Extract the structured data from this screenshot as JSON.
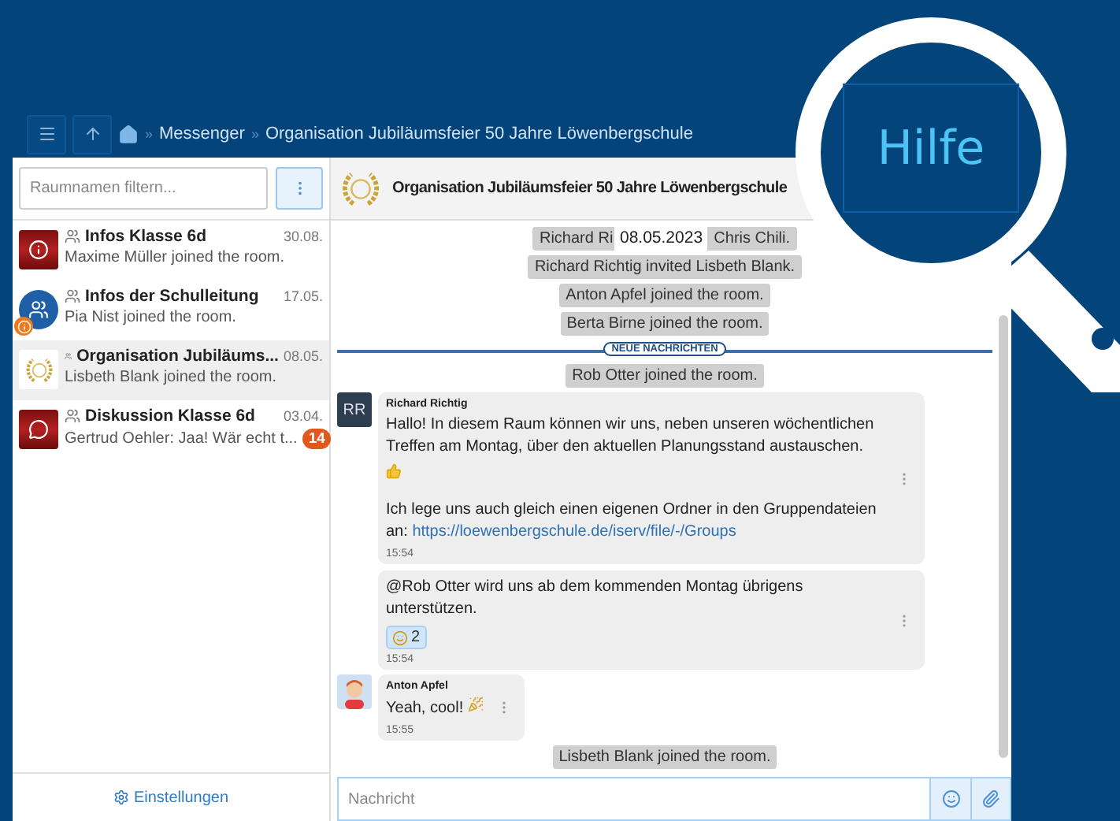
{
  "topbar": {
    "separator": "»",
    "breadcrumb": [
      "Messenger",
      "Organisation Jubiläumsfeier 50 Jahre Löwenbergschule"
    ]
  },
  "sidebar": {
    "filter": {
      "placeholder": "Raumnamen filtern..."
    },
    "rooms": [
      {
        "name": "Infos Klasse 6d",
        "date": "30.08.",
        "preview": "Maxime Müller joined the room.",
        "kind": "class-info",
        "selected": false
      },
      {
        "name": "Infos der Schulleitung",
        "date": "17.05.",
        "preview": "Pia Nist joined the room.",
        "kind": "school",
        "selected": false
      },
      {
        "name": "Organisation Jubiläums...",
        "date": "08.05.",
        "preview": "Lisbeth Blank joined the room.",
        "kind": "laurel",
        "selected": true
      },
      {
        "name": "Diskussion Klasse 6d",
        "date": "03.04.",
        "preview": "Gertrud Oehler: Jaa! Wär echt t...",
        "kind": "class-chat",
        "selected": false,
        "unread": "14"
      }
    ],
    "settings": "Einstellungen"
  },
  "chat": {
    "title": "Organisation Jubiläumsfeier 50 Jahre Löwenbergschule",
    "events": [
      {
        "kind": "covered",
        "before": "Richard Ri",
        "badge": "08.05.2023",
        "after": "Chris Chili."
      },
      {
        "kind": "system",
        "text": "Richard Richtig invited Lisbeth Blank."
      },
      {
        "kind": "system",
        "text": "Anton Apfel joined the room."
      },
      {
        "kind": "system",
        "text": "Berta Birne joined the room."
      },
      {
        "kind": "divider",
        "label": "NEUE NACHRICHTEN"
      },
      {
        "kind": "system",
        "text": "Rob Otter joined the room."
      },
      {
        "kind": "group",
        "author": "Richard Richtig",
        "avatar": {
          "kind": "initials",
          "initials": "RR"
        },
        "messages": [
          {
            "blocks": [
              {
                "kind": "text",
                "text": "Hallo! In diesem Raum können wir uns, neben unseren wöchentlichen Treffen am Montag, über den aktuellen Planungsstand austauschen."
              },
              {
                "kind": "thumbs-up"
              },
              {
                "kind": "link-text",
                "text": "Ich lege uns auch gleich einen eigenen Ordner in den Gruppendateien an:",
                "link": "https://loewenbergschule.de/iserv/file/-/Groups"
              }
            ],
            "time": "15:54"
          },
          {
            "blocks": [
              {
                "kind": "text",
                "text": "@Rob Otter wird uns ab dem kommenden Montag übrigens unterstützen."
              },
              {
                "kind": "reaction",
                "count": "2"
              }
            ],
            "time": "15:54"
          }
        ]
      },
      {
        "kind": "group",
        "author": "Anton Apfel",
        "avatar": {
          "kind": "cartoon"
        },
        "messages": [
          {
            "blocks": [
              {
                "kind": "text-party",
                "text": "Yeah, cool!"
              }
            ],
            "time": "15:55"
          }
        ]
      },
      {
        "kind": "system",
        "text": "Lisbeth Blank joined the room."
      }
    ]
  },
  "composer": {
    "placeholder": "Nachricht"
  },
  "help": {
    "label": "Hilfe"
  }
}
